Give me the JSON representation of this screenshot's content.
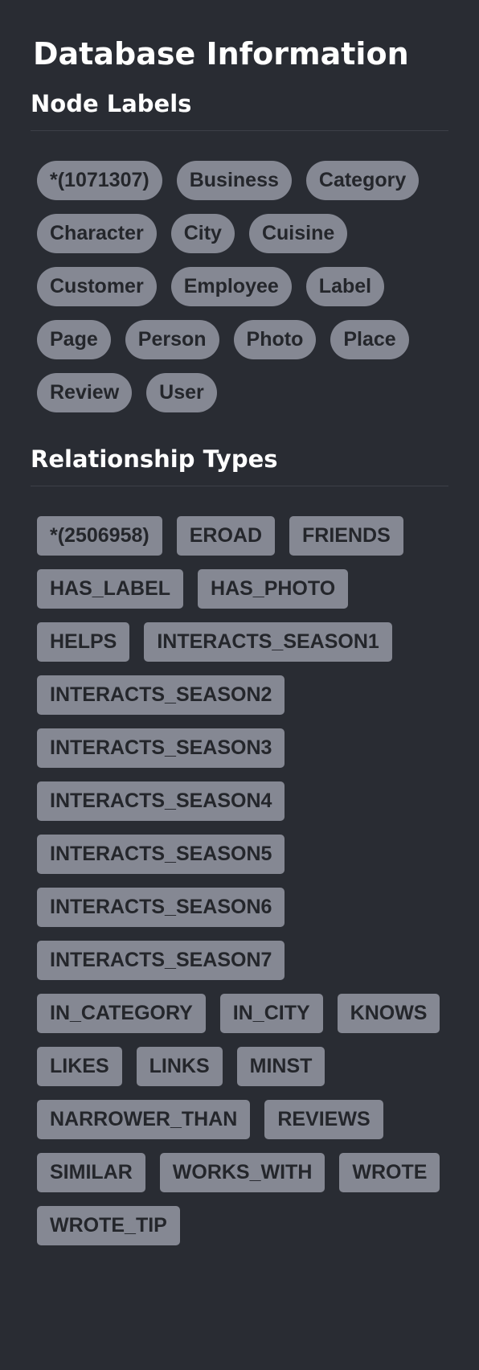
{
  "title": "Database Information",
  "node_labels": {
    "heading": "Node Labels",
    "items": [
      {
        "label": "*(1071307)"
      },
      {
        "label": "Business"
      },
      {
        "label": "Category"
      },
      {
        "label": "Character"
      },
      {
        "label": "City"
      },
      {
        "label": "Cuisine"
      },
      {
        "label": "Customer"
      },
      {
        "label": "Employee"
      },
      {
        "label": "Label"
      },
      {
        "label": "Page"
      },
      {
        "label": "Person"
      },
      {
        "label": "Photo"
      },
      {
        "label": "Place"
      },
      {
        "label": "Review"
      },
      {
        "label": "User"
      }
    ]
  },
  "relationship_types": {
    "heading": "Relationship Types",
    "items": [
      {
        "label": "*(2506958)"
      },
      {
        "label": "EROAD"
      },
      {
        "label": "FRIENDS"
      },
      {
        "label": "HAS_LABEL"
      },
      {
        "label": "HAS_PHOTO"
      },
      {
        "label": "HELPS"
      },
      {
        "label": "INTERACTS_SEASON1"
      },
      {
        "label": "INTERACTS_SEASON2"
      },
      {
        "label": "INTERACTS_SEASON3"
      },
      {
        "label": "INTERACTS_SEASON4"
      },
      {
        "label": "INTERACTS_SEASON5"
      },
      {
        "label": "INTERACTS_SEASON6"
      },
      {
        "label": "INTERACTS_SEASON7"
      },
      {
        "label": "IN_CATEGORY"
      },
      {
        "label": "IN_CITY"
      },
      {
        "label": "KNOWS"
      },
      {
        "label": "LIKES"
      },
      {
        "label": "LINKS"
      },
      {
        "label": "MINST"
      },
      {
        "label": "NARROWER_THAN"
      },
      {
        "label": "REVIEWS"
      },
      {
        "label": "SIMILAR"
      },
      {
        "label": "WORKS_WITH"
      },
      {
        "label": "WROTE"
      },
      {
        "label": "WROTE_TIP"
      }
    ]
  },
  "colors": {
    "background": "#292c33",
    "chip_background": "#858893",
    "chip_text": "#24262b",
    "heading_text": "#ffffff",
    "divider": "#3d4048"
  }
}
